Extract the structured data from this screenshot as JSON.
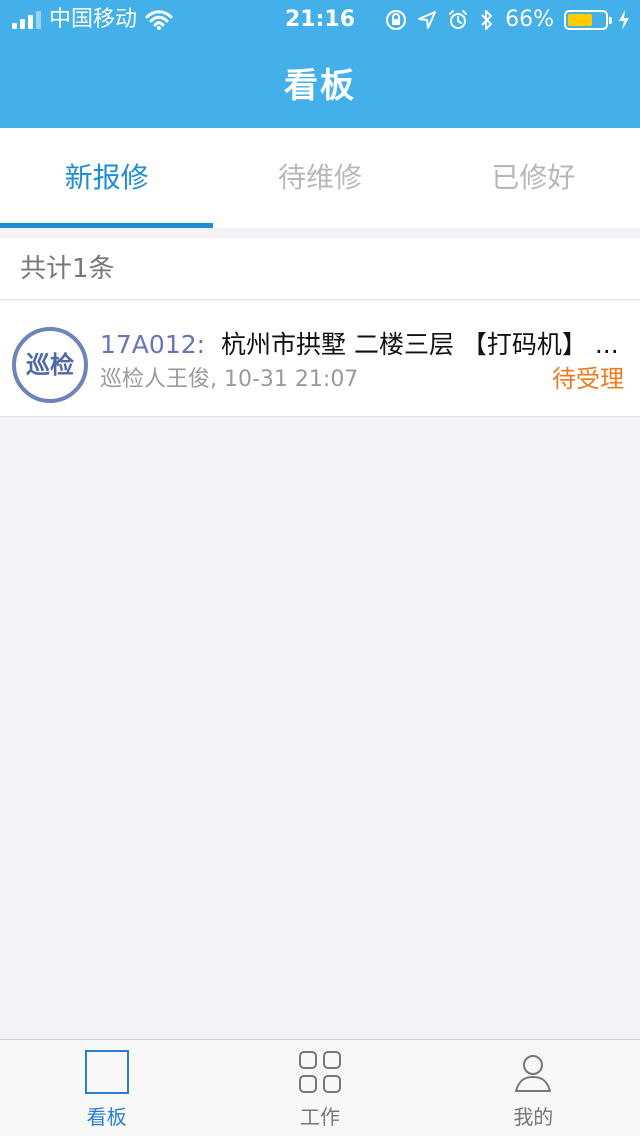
{
  "status_bar": {
    "carrier": "中国移动",
    "time": "21:16",
    "battery_percent": "66%",
    "battery_level": 0.66
  },
  "nav": {
    "title": "看板"
  },
  "tabs": [
    {
      "label": "新报修",
      "active": true
    },
    {
      "label": "待维修",
      "active": false
    },
    {
      "label": "已修好",
      "active": false
    }
  ],
  "list": {
    "count_text": "共计1条",
    "items": [
      {
        "badge": "巡检",
        "id": "17A012:",
        "title": "杭州市拱墅 二楼三层 【打码机】 ...",
        "meta": "巡检人王俊, 10-31 21:07",
        "status": "待受理"
      }
    ]
  },
  "bottom_nav": [
    {
      "label": "看板",
      "icon": "board-icon",
      "active": true
    },
    {
      "label": "工作",
      "icon": "apps-grid-icon",
      "active": false
    },
    {
      "label": "我的",
      "icon": "user-icon",
      "active": false
    }
  ],
  "colors": {
    "header": "#43b0ea",
    "active_tab": "#1f8dd6",
    "status_orange": "#f07a1c"
  }
}
